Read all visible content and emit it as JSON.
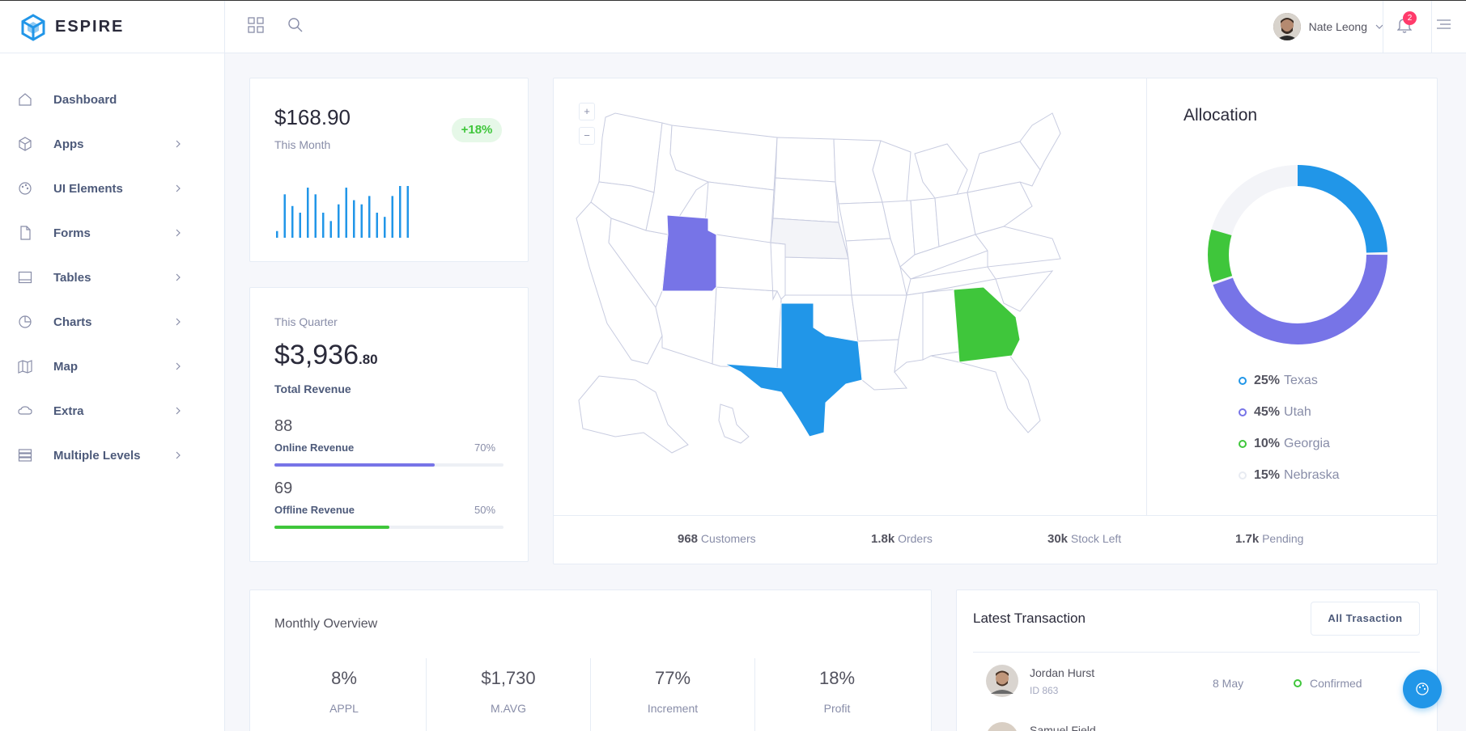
{
  "header": {
    "brand": "ESPIRE",
    "user_name": "Nate Leong",
    "notification_count": "2"
  },
  "sidebar": {
    "items": [
      {
        "label": "Dashboard",
        "icon": "home-icon"
      },
      {
        "label": "Apps",
        "icon": "cube-icon"
      },
      {
        "label": "UI Elements",
        "icon": "palette-icon"
      },
      {
        "label": "Forms",
        "icon": "file-icon"
      },
      {
        "label": "Tables",
        "icon": "table-icon"
      },
      {
        "label": "Charts",
        "icon": "pie-chart-icon"
      },
      {
        "label": "Map",
        "icon": "map-icon"
      },
      {
        "label": "Extra",
        "icon": "cloud-icon"
      },
      {
        "label": "Multiple Levels",
        "icon": "list-icon"
      }
    ]
  },
  "month_card": {
    "value": "$168.90",
    "label": "This Month",
    "change": "+18%",
    "sparkline": [
      8,
      52,
      38,
      30,
      60,
      52,
      30,
      20,
      40,
      60,
      45,
      40,
      50,
      30,
      25,
      50,
      62,
      62
    ]
  },
  "quarter_card": {
    "label": "This Quarter",
    "value_main": "$3,936",
    "value_cents": ".80",
    "value_label": "Total Revenue",
    "online": {
      "value": "88",
      "label": "Online Revenue",
      "percent": "70%",
      "fill": 0.7
    },
    "offline": {
      "value": "69",
      "label": "Offline Revenue",
      "percent": "50%",
      "fill": 0.5
    }
  },
  "map": {
    "zoom_in": "+",
    "zoom_out": "−",
    "highlighted_states": [
      {
        "name": "Utah",
        "color": "#7774e7"
      },
      {
        "name": "Texas",
        "color": "#2196e8"
      },
      {
        "name": "Georgia",
        "color": "#3fc63b"
      },
      {
        "name": "Nebraska",
        "color": "#f3f4f8"
      }
    ]
  },
  "stats": [
    {
      "value": "968",
      "label": "Customers"
    },
    {
      "value": "1.8k",
      "label": "Orders"
    },
    {
      "value": "30k",
      "label": "Stock Left"
    },
    {
      "value": "1.7k",
      "label": "Pending"
    }
  ],
  "allocation": {
    "title": "Allocation",
    "items": [
      {
        "percent": "25%",
        "state": "Texas",
        "color": "#2196e8"
      },
      {
        "percent": "45%",
        "state": "Utah",
        "color": "#7774e7"
      },
      {
        "percent": "10%",
        "state": "Georgia",
        "color": "#3fc63b"
      },
      {
        "percent": "15%",
        "state": "Nebraska",
        "color": "#e8ebf2"
      }
    ]
  },
  "monthly_overview": {
    "title": "Monthly Overview",
    "items": [
      {
        "value": "8%",
        "label": "APPL"
      },
      {
        "value": "$1,730",
        "label": "M.AVG"
      },
      {
        "value": "77%",
        "label": "Increment"
      },
      {
        "value": "18%",
        "label": "Profit"
      }
    ]
  },
  "transactions": {
    "title": "Latest Transaction",
    "button": "All Trasaction",
    "rows": [
      {
        "name": "Jordan Hurst",
        "id": "ID 863",
        "date": "8 May",
        "status": "Confirmed",
        "status_color": "#3fc63b"
      },
      {
        "name": "Samuel Field"
      }
    ]
  }
}
